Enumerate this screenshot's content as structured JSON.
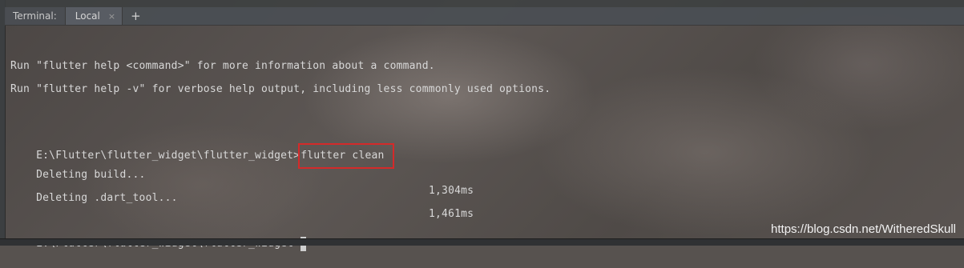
{
  "tabs": {
    "title": "Terminal:",
    "local_label": "Local",
    "close_glyph": "×",
    "add_glyph": "+"
  },
  "terminal": {
    "help_line_1": "Run \"flutter help <command>\" for more information about a command.",
    "help_line_2": "Run \"flutter help -v\" for verbose help output, including less commonly used options.",
    "prompt_1": "E:\\Flutter\\flutter_widget\\flutter_widget>",
    "command": "flutter clean",
    "delete_build": "Deleting build...",
    "delete_build_time": "1,304ms",
    "delete_dart_tool": "Deleting .dart_tool...",
    "delete_dart_tool_time": "1,461ms",
    "prompt_2": "E:\\Flutter\\flutter_widget\\flutter_widget>"
  },
  "watermark": "https://blog.csdn.net/WitheredSkull",
  "colors": {
    "highlight_box": "#d42a2a",
    "terminal_text": "#d8d8d8"
  }
}
